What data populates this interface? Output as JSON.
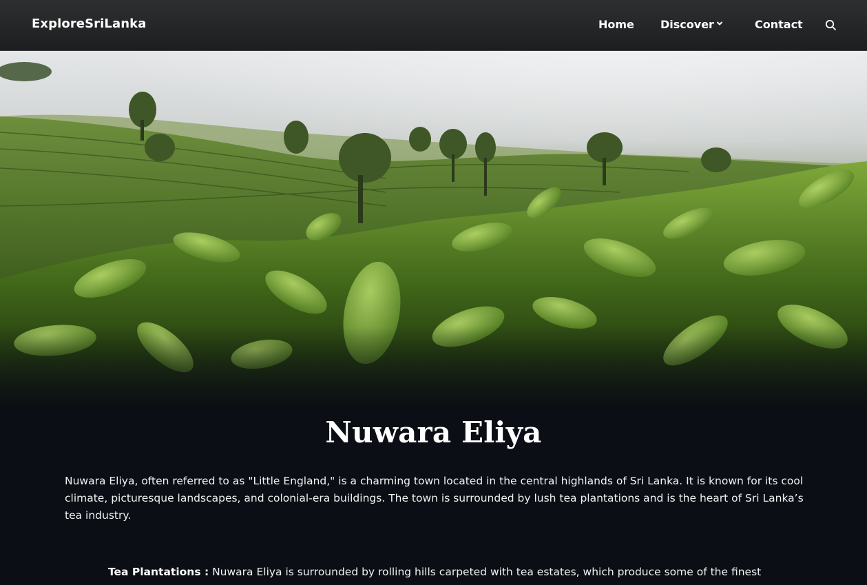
{
  "navbar": {
    "brand": "ExploreSriLanka",
    "links": {
      "home": "Home",
      "discover": "Discover",
      "contact": "Contact"
    },
    "icons": [
      "chevron-down-icon",
      "search-icon"
    ]
  },
  "hero": {
    "image": "tea-plantation-photo"
  },
  "page": {
    "title": "Nuwara Eliya",
    "intro": "Nuwara Eliya, often referred to as \"Little England,\" is a charming town located in the central highlands of Sri Lanka. It is known for its cool climate, picturesque landscapes, and colonial-era buildings. The town is surrounded by lush tea plantations and is the heart of Sri Lanka’s tea industry.",
    "sections": [
      {
        "heading": "Tea Plantations :",
        "text": " Nuwara Eliya is surrounded by rolling hills carpeted with tea estates, which produce some of the finest"
      }
    ]
  },
  "colors": {
    "navbar_bg": "#262728",
    "page_bg": "#0b0e15",
    "text": "#ffffff"
  }
}
